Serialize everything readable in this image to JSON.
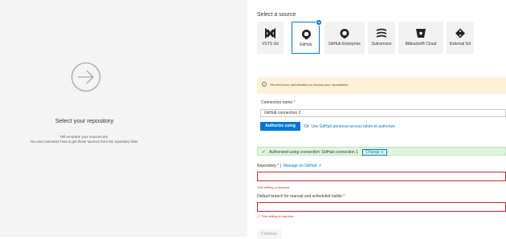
{
  "left_panel": {
    "title": "Select your repository",
    "subtitle_line1": "Tell us where your sources are.",
    "subtitle_line2": "You can customize how to get these sources from the repository later.",
    "icon": "arrow-right-circle-icon"
  },
  "source": {
    "heading": "Select a source",
    "tiles": [
      {
        "label": "VSTS Git",
        "icon": "vsts-git-icon",
        "selected": false
      },
      {
        "label": "GitHub",
        "icon": "github-icon",
        "selected": true
      },
      {
        "label": "GitHub Enterprise",
        "icon": "github-enterprise-icon",
        "selected": false
      },
      {
        "label": "Subversion",
        "icon": "subversion-icon",
        "selected": false
      },
      {
        "label": "Bitbucket® Cloud",
        "icon": "bitbucket-icon",
        "selected": false
      },
      {
        "label": "External Git",
        "icon": "external-git-icon",
        "selected": false
      }
    ]
  },
  "warning": {
    "text": "We need your authorization to access your repositories",
    "icon": "info-icon"
  },
  "connection": {
    "label": "Connection name *",
    "value": "GitHub connection 2",
    "oauth_button": "Authorize using OAuth",
    "or_text": "Or",
    "token_link": "Use GitHub personal access token to authorize"
  },
  "authorized": {
    "text": "Authorized using connection: GitHub connection 1",
    "change_label": "Change",
    "chevron": "∨"
  },
  "repository": {
    "label": "Repository * |",
    "manage_link": "Manage on GitHub",
    "external_icon": "⇗",
    "error": "This setting is required."
  },
  "branch": {
    "label": "Default branch for manual and scheduled builds *",
    "error": "This setting is required."
  },
  "continue_button": "Continue",
  "colors": {
    "accent": "#0078d4",
    "error": "#c4262e",
    "success_bg": "#dff6dd",
    "warning_bg": "#fdf2d5"
  }
}
